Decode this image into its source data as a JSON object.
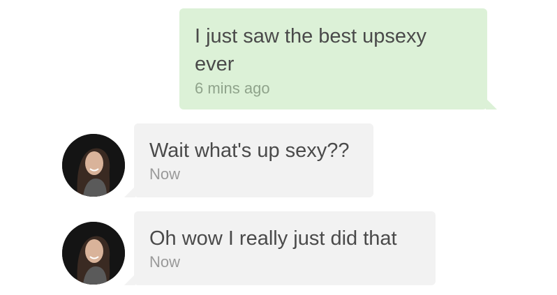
{
  "messages": [
    {
      "direction": "outgoing",
      "text": "I just saw the best upsexy ever",
      "time": "6 mins ago"
    },
    {
      "direction": "incoming",
      "text": "Wait what's up sexy??",
      "time": "Now",
      "avatar_icon": "user-photo-avatar"
    },
    {
      "direction": "incoming",
      "text": "Oh wow I really just did that",
      "time": "Now",
      "avatar_icon": "user-photo-avatar"
    }
  ],
  "colors": {
    "outgoing_bubble": "#dcf1d7",
    "incoming_bubble": "#f2f2f2",
    "text": "#4a4a4a",
    "timestamp": "#9a9a9a"
  }
}
